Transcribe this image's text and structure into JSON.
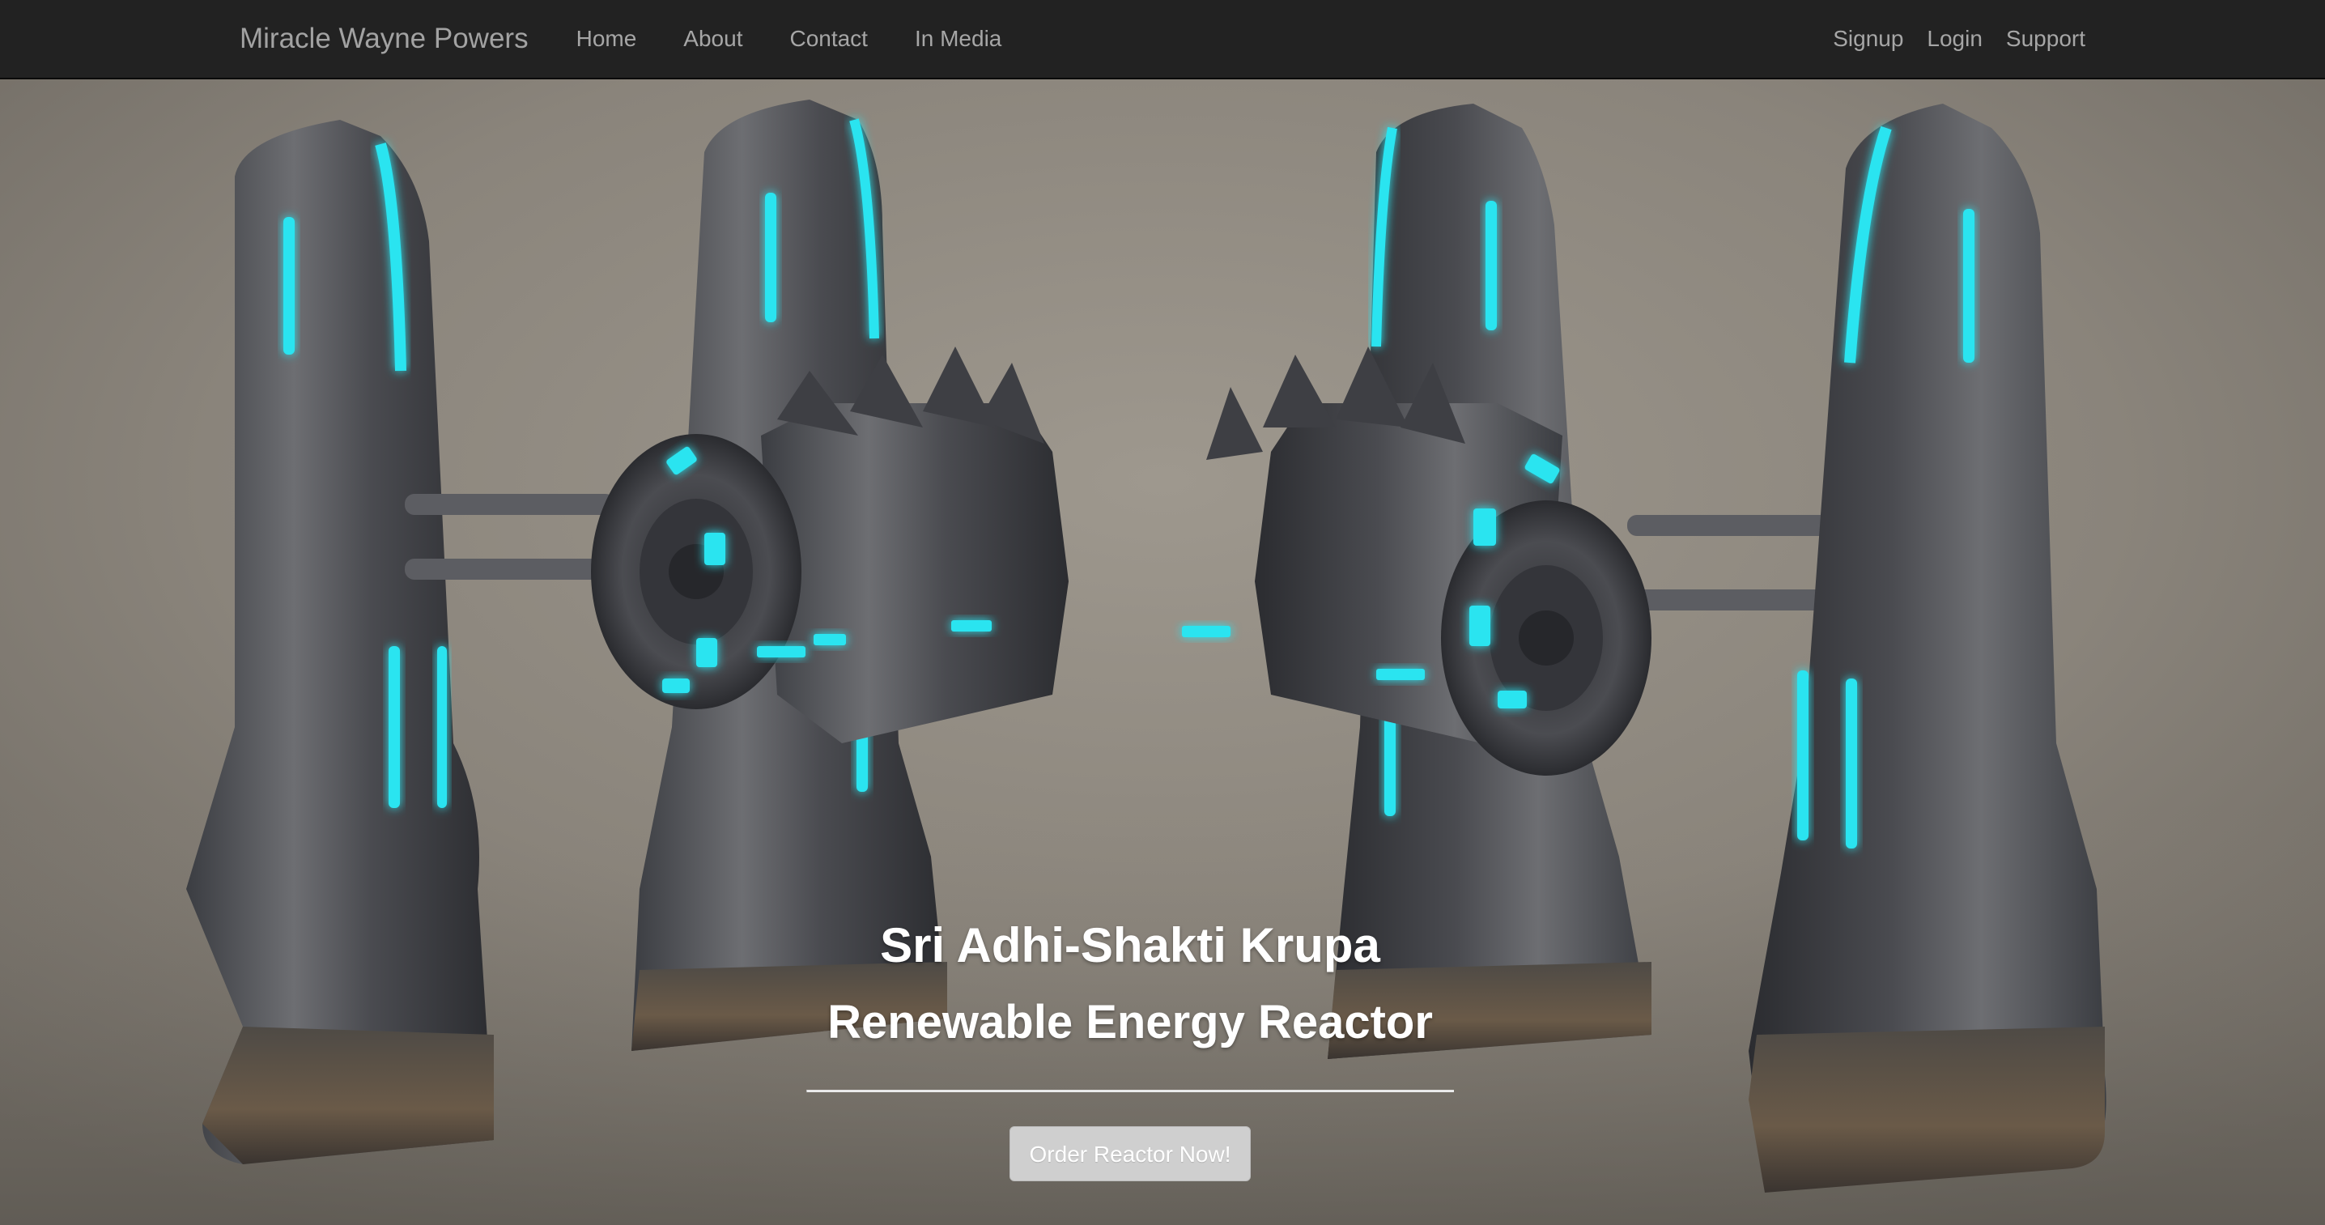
{
  "navbar": {
    "brand": "Miracle Wayne Powers",
    "left_links": [
      "Home",
      "About",
      "Contact",
      "In Media"
    ],
    "right_links": [
      "Signup",
      "Login",
      "Support"
    ],
    "background": "#222222"
  },
  "hero": {
    "title": "Sri Adhi-Shakti Krupa",
    "subtitle": "Renewable Energy Reactor",
    "cta_label": "Order Reactor Now!",
    "accent_glow": "#27e4f0"
  }
}
